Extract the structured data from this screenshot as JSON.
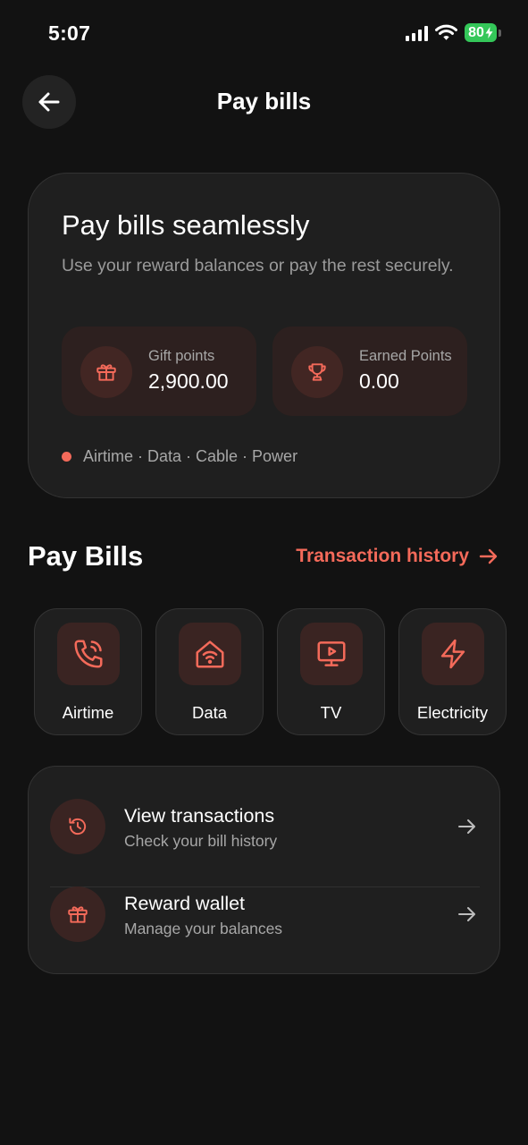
{
  "status_bar": {
    "time": "5:07",
    "battery": "80"
  },
  "header": {
    "title": "Pay bills"
  },
  "hero": {
    "title": "Pay bills seamlessly",
    "subtitle": "Use your reward balances or pay the rest securely.",
    "gift_points": {
      "label": "Gift points",
      "value": "2,900.00",
      "icon": "gift-icon"
    },
    "earned_points": {
      "label": "Earned Points",
      "value": "0.00",
      "icon": "trophy-icon"
    },
    "tags": "Airtime · Data · Cable · Power"
  },
  "section": {
    "title": "Pay Bills",
    "history_link": "Transaction history"
  },
  "bills": [
    {
      "label": "Airtime",
      "icon": "phone-icon"
    },
    {
      "label": "Data",
      "icon": "wifi-house-icon"
    },
    {
      "label": "TV",
      "icon": "tv-play-icon"
    },
    {
      "label": "Electricity",
      "icon": "lightning-icon"
    }
  ],
  "actions": [
    {
      "title": "View transactions",
      "subtitle": "Check your bill history",
      "icon": "history-icon"
    },
    {
      "title": "Reward wallet",
      "subtitle": "Manage your balances",
      "icon": "gift-icon"
    }
  ],
  "colors": {
    "accent": "#f46a5a",
    "background": "#121212",
    "card": "#1f1f1f",
    "battery": "#34c759"
  }
}
